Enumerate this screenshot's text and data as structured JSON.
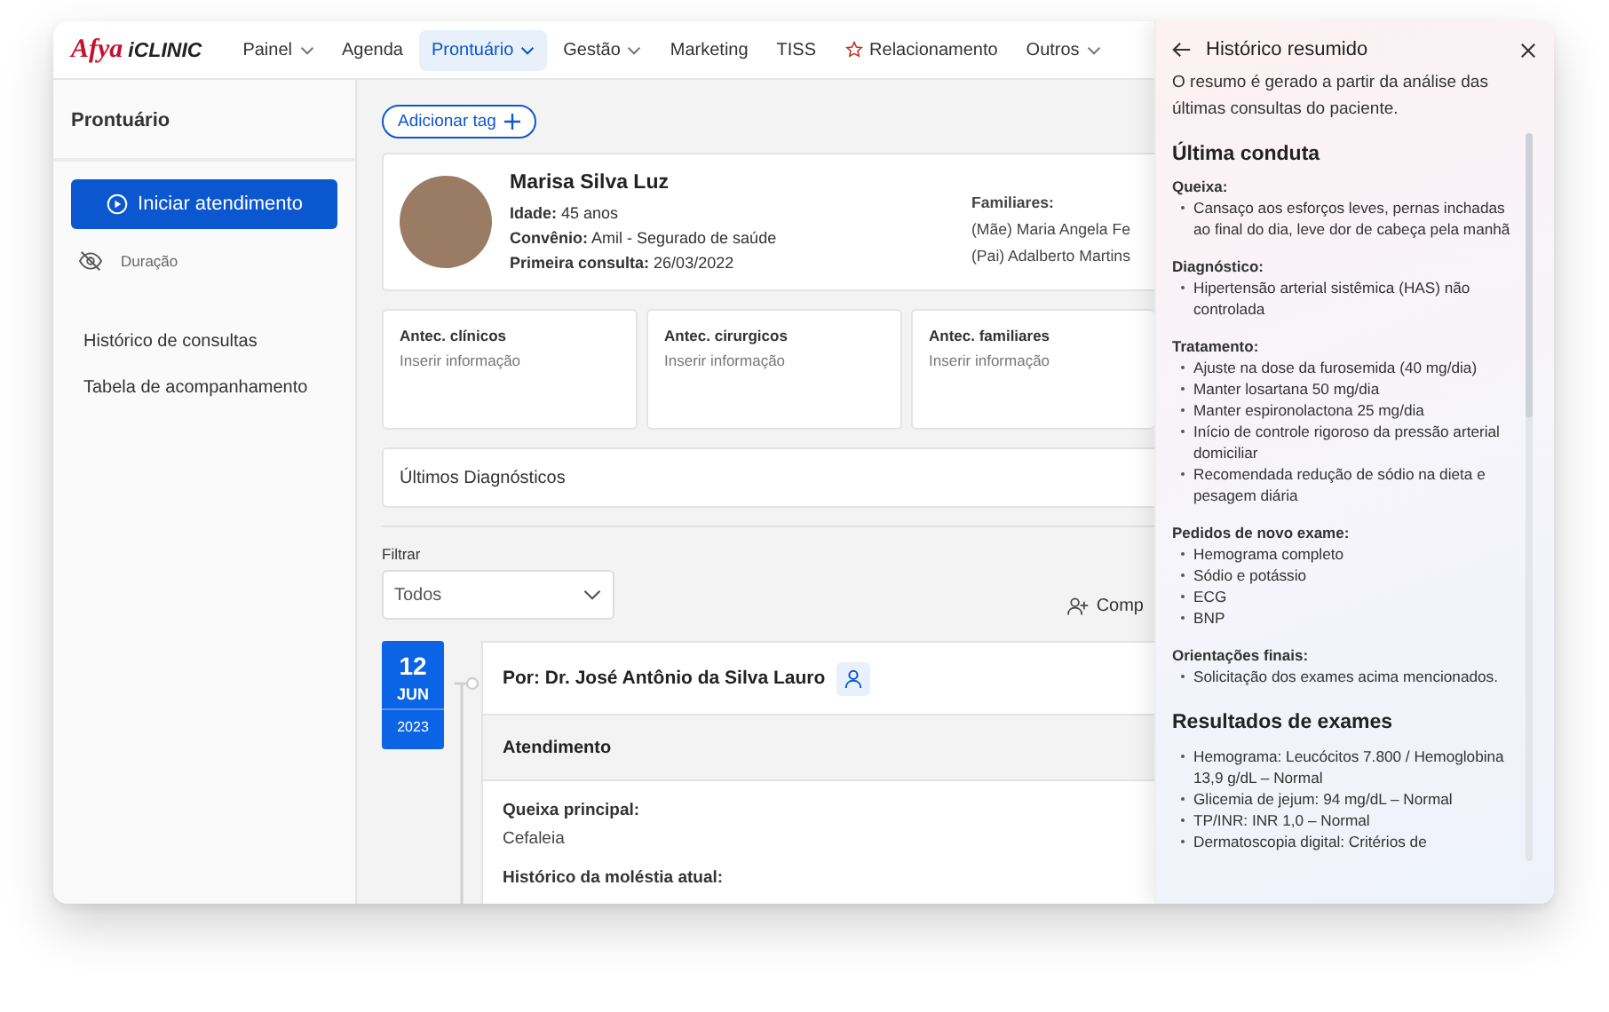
{
  "logo": {
    "brand": "Afya",
    "product": "iCLINIC"
  },
  "nav": [
    {
      "kind": "plain",
      "label": "Painel",
      "caret": true,
      "selected": false
    },
    {
      "kind": "plain",
      "label": "Agenda",
      "caret": false,
      "selected": false
    },
    {
      "kind": "plain",
      "label": "Prontuário",
      "caret": true,
      "selected": true
    },
    {
      "kind": "plain",
      "label": "Gestão",
      "caret": true,
      "selected": false
    },
    {
      "kind": "plain",
      "label": "Marketing",
      "caret": false,
      "selected": false
    },
    {
      "kind": "plain",
      "label": "TISS",
      "caret": false,
      "selected": false
    },
    {
      "kind": "starred",
      "label": "Relacionamento",
      "caret": false,
      "selected": false
    },
    {
      "kind": "plain",
      "label": "Outros",
      "caret": true,
      "selected": false
    }
  ],
  "sidebar": {
    "title": "Prontuário",
    "start_button": "Iniciar atendimento",
    "duration": "Duração",
    "items": [
      "Histórico de consultas",
      "Tabela de acompanhamento"
    ]
  },
  "add_tag": "Adicionar tag",
  "patient": {
    "name": "Marisa Silva Luz",
    "fields": [
      {
        "label": "Idade:",
        "value": "45 anos"
      },
      {
        "label": "Convênio:",
        "value": "Amil - Segurado de saúde"
      },
      {
        "label": "Primeira consulta:",
        "value": "26/03/2022"
      }
    ],
    "relatives_label": "Familiares:",
    "relatives": [
      "(Mãe) Maria Angela Fe",
      "(Pai) Adalberto Martins"
    ]
  },
  "history_cards": [
    {
      "title": "Antec. clínicos",
      "placeholder": "Inserir informação"
    },
    {
      "title": "Antec. cirurgicos",
      "placeholder": "Inserir informação"
    },
    {
      "title": "Antec. familiares",
      "placeholder": "Inserir informação"
    }
  ],
  "diagnostics_title": "Últimos Diagnósticos",
  "filter": {
    "label": "Filtrar",
    "value": "Todos"
  },
  "share_button": "Comp",
  "consultation": {
    "day": "12",
    "month": "JUN",
    "year": "2023",
    "doctor": "Por: Dr. José Antônio da Silva Lauro",
    "section": "Atendimento",
    "fields": [
      {
        "label": "Queixa principal:",
        "value": "Cefaleia"
      },
      {
        "label": "Histórico da moléstia atual:"
      }
    ]
  },
  "summary_panel": {
    "title": "Histórico resumido",
    "intro": "O resumo é gerado a partir da análise das últimas consultas do paciente.",
    "sections": [
      {
        "kind": "groups",
        "heading": "Última conduta",
        "groups": [
          {
            "label": "Queixa:",
            "items": [
              "Cansaço aos esforços leves, pernas inchadas ao final do dia, leve dor de cabeça pela manhã"
            ]
          },
          {
            "label": "Diagnóstico:",
            "items": [
              "Hipertensão arterial sistêmica (HAS) não controlada"
            ]
          },
          {
            "label": "Tratamento:",
            "items": [
              "Ajuste na dose da furosemida (40 mg/dia)",
              "Manter losartana 50 mg/dia",
              "Manter espironolactona 25 mg/dia",
              "Início de controle rigoroso da pressão arterial domiciliar",
              "Recomendada redução de sódio na dieta e pesagem diária"
            ]
          },
          {
            "label": "Pedidos de novo exame:",
            "items": [
              "Hemograma completo",
              "Sódio e potássio",
              "ECG",
              "BNP"
            ]
          },
          {
            "label": "Orientações finais:",
            "items": [
              "Solicitação  dos exames  acima mencionados."
            ]
          }
        ]
      },
      {
        "kind": "list",
        "heading": "Resultados de exames",
        "items": [
          "Hemograma: Leucócitos 7.800 / Hemoglobina 13,9 g/dL – Normal",
          "Glicemia de jejum: 94 mg/dL – Normal",
          "TP/INR: INR 1,0 – Normal",
          "Dermatoscopia digital: Critérios de"
        ]
      }
    ]
  }
}
